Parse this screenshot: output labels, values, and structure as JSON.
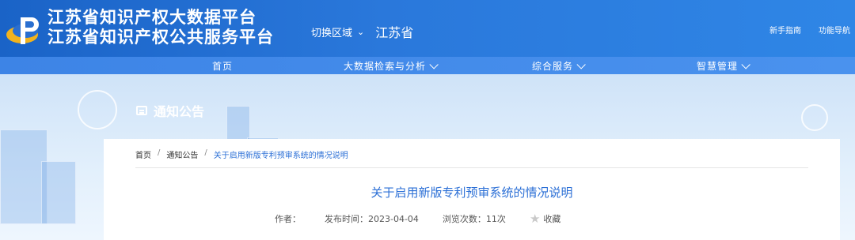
{
  "header": {
    "title_line1": "江苏省知识产权大数据平台",
    "title_line2": "江苏省知识产权公共服务平台",
    "region_label": "切换区域",
    "region_value": "江苏省",
    "link_newbie": "新手指南",
    "link_nav": "功能导航"
  },
  "nav": {
    "home": "首页",
    "bigdata": "大数据检索与分析",
    "service": "综合服务",
    "manage": "智慧管理"
  },
  "section": {
    "title": "通知公告"
  },
  "breadcrumb": {
    "home": "首页",
    "sep": "/",
    "notice": "通知公告",
    "current": "关于启用新版专利预审系统的情况说明"
  },
  "article": {
    "title": "关于启用新版专利预审系统的情况说明",
    "author_label": "作者：",
    "date_label": "发布时间：2023-04-04",
    "views_label": "浏览次数：11次",
    "favorite_label": "收藏"
  },
  "colors": {
    "header_blue": "#1a63c7",
    "link_blue": "#2b6fd6"
  }
}
